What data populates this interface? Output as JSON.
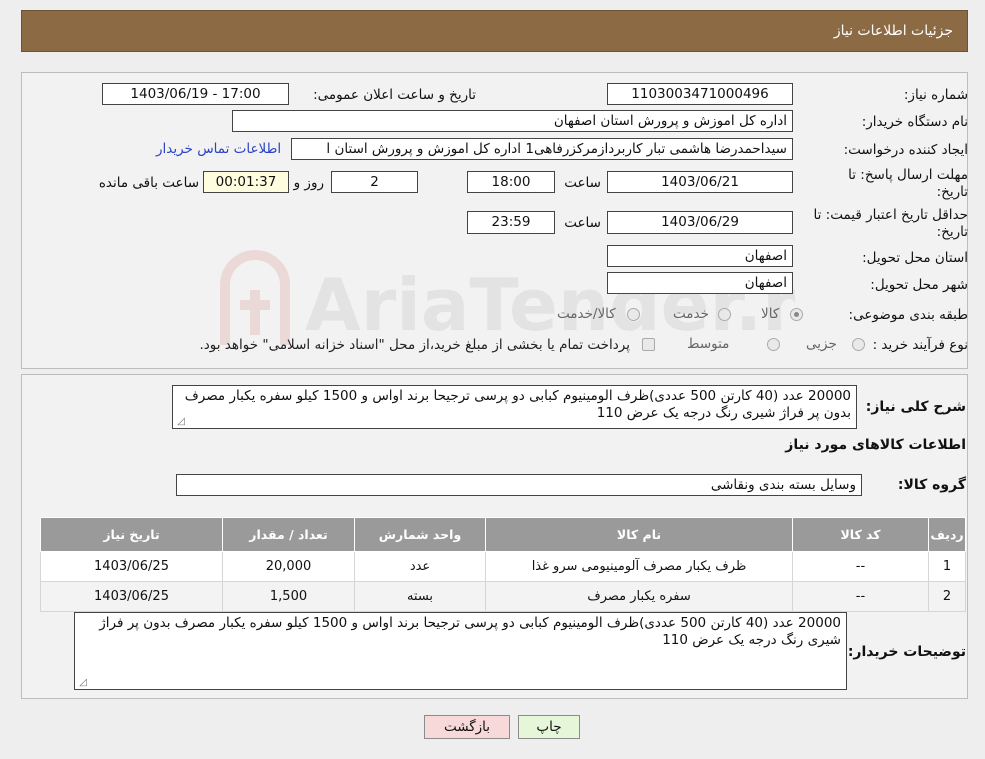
{
  "header": {
    "title": "جزئیات اطلاعات نیاز"
  },
  "fields": {
    "need_number_label": "شماره نیاز:",
    "need_number": "1103003471000496",
    "announce_label": "تاریخ و ساعت اعلان عمومی:",
    "announce_value": "1403/06/19 - 17:00",
    "buyer_org_label": "نام دستگاه خریدار:",
    "buyer_org": "اداره کل اموزش و پرورش استان اصفهان",
    "requester_label": "ایجاد کننده درخواست:",
    "requester": "سیداحمدرضا هاشمی تبار کاربردازمرکزرفاهی1 اداره کل اموزش و پرورش استان ا",
    "contact_link": "اطلاعات تماس خریدار",
    "deadline_label_1": "مهلت ارسال پاسخ: تا",
    "deadline_label_2": "تاریخ:",
    "deadline_date": "1403/06/21",
    "hour_label": "ساعت",
    "deadline_time": "18:00",
    "days_value": "2",
    "days_label": "روز و",
    "remaining_time": "00:01:37",
    "remaining_label": "ساعت باقی مانده",
    "validity_label_1": "حداقل تاریخ اعتبار قیمت: تا",
    "validity_label_2": "تاریخ:",
    "validity_date": "1403/06/29",
    "validity_time": "23:59",
    "province_label": "استان محل تحویل:",
    "province": "اصفهان",
    "city_label": "شهر محل تحویل:",
    "city": "اصفهان",
    "category_label": "طبقه بندی موضوعی:",
    "category_options": [
      "کالا",
      "خدمت",
      "کالا/خدمت"
    ],
    "process_label": "نوع فرآیند خرید :",
    "process_options": [
      "جزیی",
      "متوسط"
    ],
    "process_note": "پرداخت تمام یا بخشی از مبلغ خرید،از محل \"اسناد خزانه اسلامی\" خواهد بود."
  },
  "description": {
    "label": "شرح کلی نیاز:",
    "text": "20000 عدد (40 کارتن 500 عددی)ظرف الومینیوم کبابی دو پرسی ترجیحا برند اواس و 1500 کیلو سفره یکبار مصرف بدون پر فراژ شیری رنگ درجه یک عرض 110"
  },
  "goods_section_title": "اطلاعات کالاهای مورد نیاز",
  "goods_group": {
    "label": "گروه کالا:",
    "value": "وسایل بسته بندی  ونقاشی"
  },
  "table": {
    "headers": [
      "ردیف",
      "کد کالا",
      "نام کالا",
      "واحد شمارش",
      "تعداد / مقدار",
      "تاریخ نیاز"
    ],
    "rows": [
      [
        "1",
        "--",
        "ظرف یکبار مصرف آلومینیومی سرو غذا",
        "عدد",
        "20,000",
        "1403/06/25"
      ],
      [
        "2",
        "--",
        "سفره یکبار مصرف",
        "بسته",
        "1,500",
        "1403/06/25"
      ]
    ]
  },
  "buyer_notes": {
    "label": "توضیحات خریدار:",
    "text": "20000 عدد (40 کارتن 500 عددی)ظرف الومینیوم کبابی دو پرسی ترجیحا برند اواس و 1500 کیلو سفره یکبار مصرف بدون پر فراژ شیری رنگ درجه یک عرض 110"
  },
  "buttons": {
    "print": "چاپ",
    "back": "بازگشت"
  },
  "watermark": "AriaTender.neT",
  "colors": {
    "header": "#8b6a44",
    "link": "#2a43c8",
    "back_button": "#f7d9d9",
    "print_button": "#e6f7d9"
  }
}
